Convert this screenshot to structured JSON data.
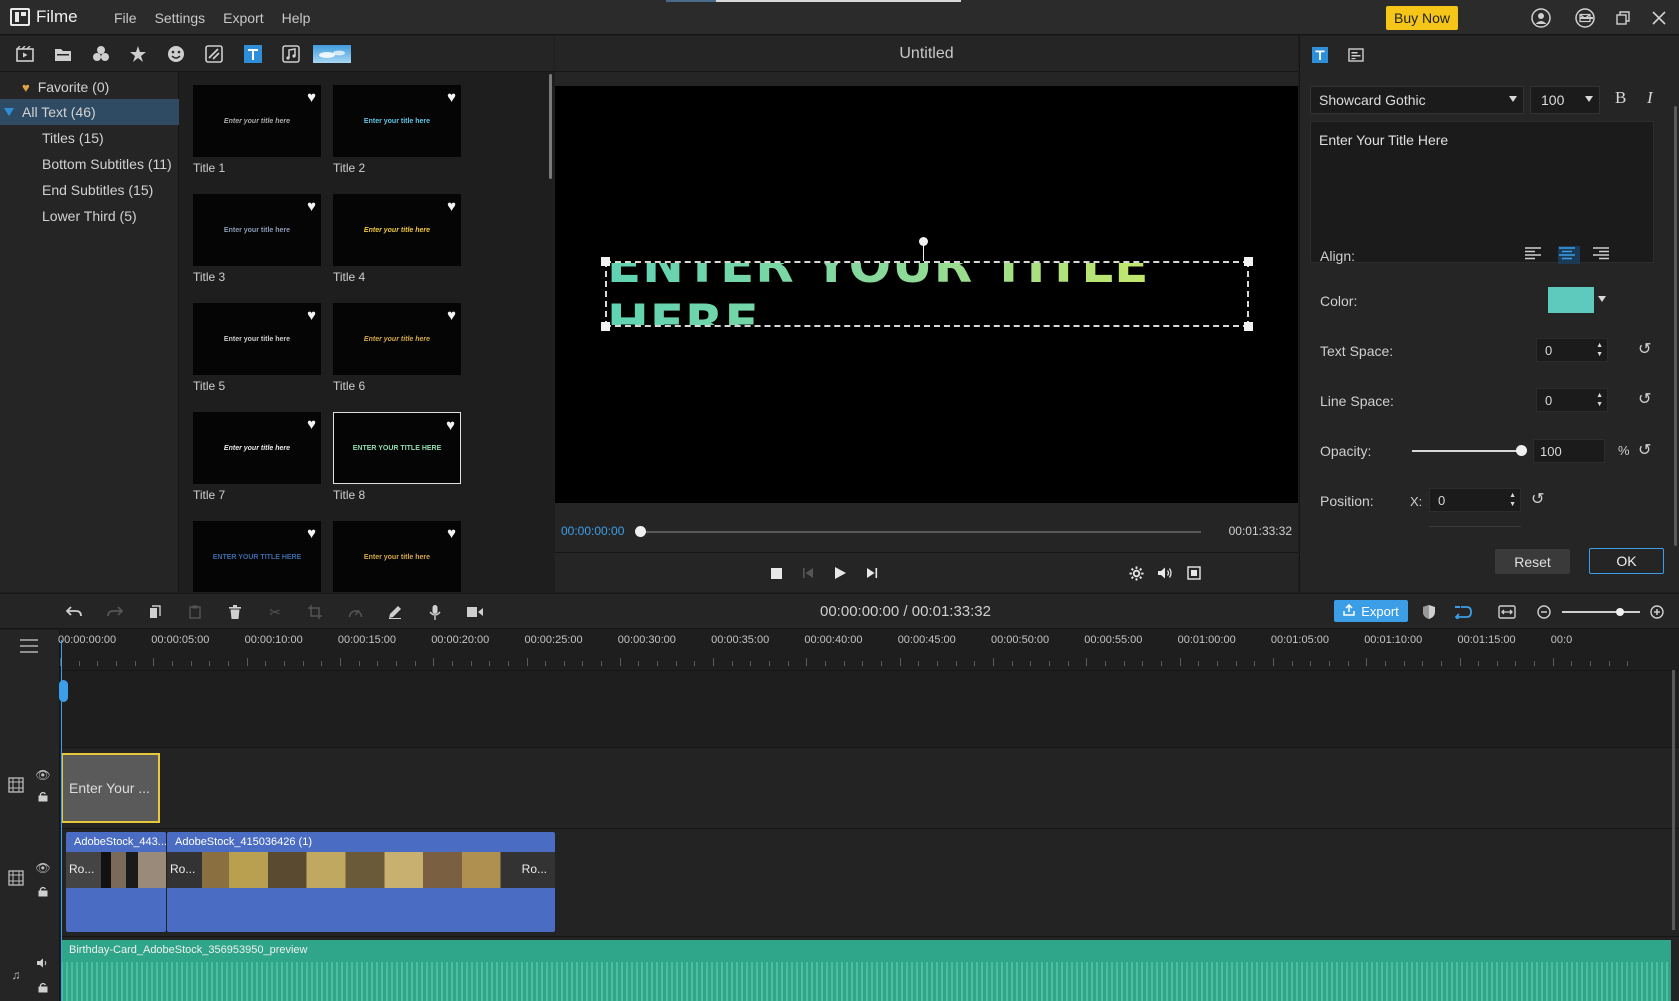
{
  "app": {
    "name": "Filme"
  },
  "menu": [
    "File",
    "Settings",
    "Export",
    "Help"
  ],
  "buy_now": "Buy Now",
  "library": {
    "tree": [
      {
        "label": "Favorite (0)",
        "selected": false
      },
      {
        "label": "All Text (46)",
        "selected": true
      },
      {
        "label": "Titles (15)",
        "selected": false
      },
      {
        "label": "Bottom Subtitles (11)",
        "selected": false
      },
      {
        "label": "End Subtitles (15)",
        "selected": false
      },
      {
        "label": "Lower Third (5)",
        "selected": false
      }
    ],
    "thumbs": [
      {
        "label": "Title 1",
        "preview": "Enter your title here",
        "color": "#aaaaaa"
      },
      {
        "label": "Title 2",
        "preview": "Enter your title here",
        "color": "#5fc6e8"
      },
      {
        "label": "Title 3",
        "preview": "Enter your title here",
        "color": "#8a9bb5"
      },
      {
        "label": "Title 4",
        "preview": "Enter your title here",
        "color": "#f0c83a"
      },
      {
        "label": "Title 5",
        "preview": "Enter your title here",
        "color": "#cccccc"
      },
      {
        "label": "Title 6",
        "preview": "Enter your title here",
        "color": "#d4a84a"
      },
      {
        "label": "Title 7",
        "preview": "Enter your title here",
        "color": "#e8e8e8"
      },
      {
        "label": "Title 8",
        "preview": "ENTER YOUR TITLE HERE",
        "color": "#8fdcb0"
      },
      {
        "label": "",
        "preview": "ENTER YOUR TITLE HERE",
        "color": "#3a6aa8"
      },
      {
        "label": "",
        "preview": "Enter your title here",
        "color": "#d4a84a"
      }
    ]
  },
  "preview": {
    "title": "Untitled",
    "canvas_text": "ENTER YOUR TITLE HERE",
    "current_time": "00:00:00:00",
    "total_time": "00:01:33:32"
  },
  "props": {
    "font": "Showcard Gothic",
    "size": "100",
    "bold": "B",
    "italic": "I",
    "text": "Enter Your Title Here",
    "align_label": "Align:",
    "color_label": "Color:",
    "color_value": "#5ec9bd",
    "text_space_label": "Text Space:",
    "text_space": "0",
    "line_space_label": "Line Space:",
    "line_space": "0",
    "opacity_label": "Opacity:",
    "opacity": "100",
    "opacity_level": 1.0,
    "opacity_unit": "%",
    "position_label": "Position:",
    "x_label": "X:",
    "x_value": "0",
    "reset": "Reset",
    "ok": "OK"
  },
  "timeline": {
    "time": "00:00:00:00 / 00:01:33:32",
    "export": "Export",
    "ticks": [
      "00:00:00:00",
      "00:00:05:00",
      "00:00:10:00",
      "00:00:15:00",
      "00:00:20:00",
      "00:00:25:00",
      "00:00:30:00",
      "00:00:35:00",
      "00:00:40:00",
      "00:00:45:00",
      "00:00:50:00",
      "00:00:55:00",
      "00:01:00:00",
      "00:01:05:00",
      "00:01:10:00",
      "00:01:15:00",
      "00:0"
    ],
    "text_clip": "Enter Your ...",
    "video_clips": [
      {
        "title": "AdobeStock_443...",
        "thumb": "Ro..."
      },
      {
        "title": "AdobeStock_415036426 (1)",
        "thumb": "Ro..."
      }
    ],
    "video_end_thumb": "Ro...",
    "audio_clip": "Birthday-Card_AdobeStock_356953950_preview"
  }
}
